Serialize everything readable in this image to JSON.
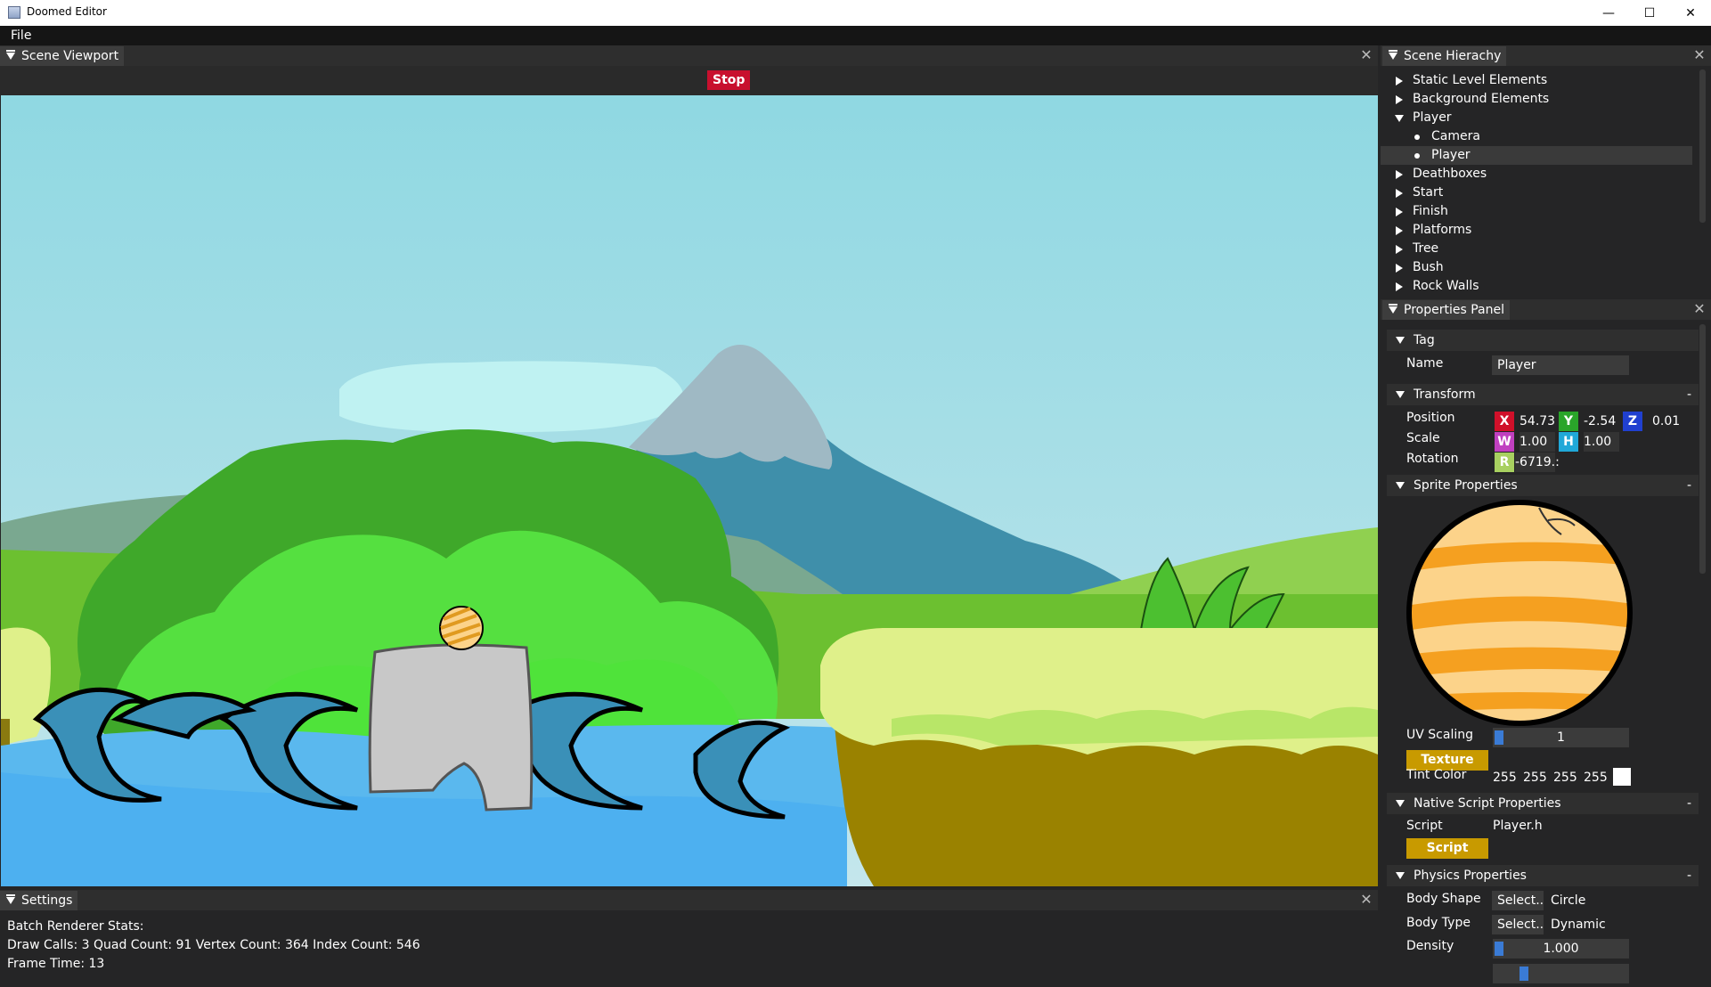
{
  "window": {
    "title": "Doomed Editor",
    "minimize": "—",
    "maximize": "☐",
    "close": "✕"
  },
  "menu": {
    "file": "File"
  },
  "viewport": {
    "tab": "Scene Viewport",
    "stop": "Stop"
  },
  "settings": {
    "tab": "Settings",
    "heading": "Batch Renderer Stats:",
    "stats": "Draw Calls: 3  Quad Count: 91  Vertex Count: 364  Index Count: 546",
    "frame_time": "Frame Time: 13"
  },
  "hierarchy": {
    "tab": "Scene Hierachy",
    "items": [
      {
        "label": "Static Level Elements"
      },
      {
        "label": "Background Elements"
      },
      {
        "label": "Player"
      },
      {
        "label": "Camera"
      },
      {
        "label": "Player"
      },
      {
        "label": "Deathboxes"
      },
      {
        "label": "Start"
      },
      {
        "label": "Finish"
      },
      {
        "label": "Platforms"
      },
      {
        "label": "Tree"
      },
      {
        "label": "Bush"
      },
      {
        "label": "Rock Walls"
      }
    ]
  },
  "properties": {
    "tab": "Properties Panel",
    "tag": {
      "header": "Tag",
      "name_label": "Name",
      "name_value": "Player"
    },
    "transform": {
      "header": "Transform",
      "collapse": "-",
      "position_label": "Position",
      "scale_label": "Scale",
      "rotation_label": "Rotation",
      "x_label": "X",
      "x": "54.73",
      "y_label": "Y",
      "y": "-2.54",
      "z_label": "Z",
      "z": "0.01",
      "w_label": "W",
      "w": "1.00",
      "h_label": "H",
      "h": "1.00",
      "r_label": "R",
      "r": "-6719.:"
    },
    "sprite": {
      "header": "Sprite Properties",
      "collapse": "-",
      "uv_label": "UV Scaling",
      "uv_value": "1",
      "texture_button": "Texture",
      "tint_label": "Tint Color",
      "tint_r": "255",
      "tint_g": "255",
      "tint_b": "255",
      "tint_a": "255",
      "tint_swatch": "#ffffff"
    },
    "script": {
      "header": "Native Script Properties",
      "collapse": "-",
      "script_label": "Script",
      "script_value": "Player.h",
      "script_button": "Script"
    },
    "physics": {
      "header": "Physics Properties",
      "collapse": "-",
      "shape_label": "Body Shape",
      "shape_select": "Select..",
      "shape_value": "Circle",
      "type_label": "Body Type",
      "type_select": "Select..",
      "type_value": "Dynamic",
      "density_label": "Density",
      "density_value": "1.000"
    }
  },
  "colors": {
    "x_axis": "#d0102a",
    "y_axis": "#2aa52a",
    "z_axis": "#2040d0",
    "w_axis": "#c040c0",
    "h_axis": "#20a8d8",
    "r_axis": "#a8d060",
    "stop": "#c8102e",
    "gold_button": "#c89a00"
  }
}
